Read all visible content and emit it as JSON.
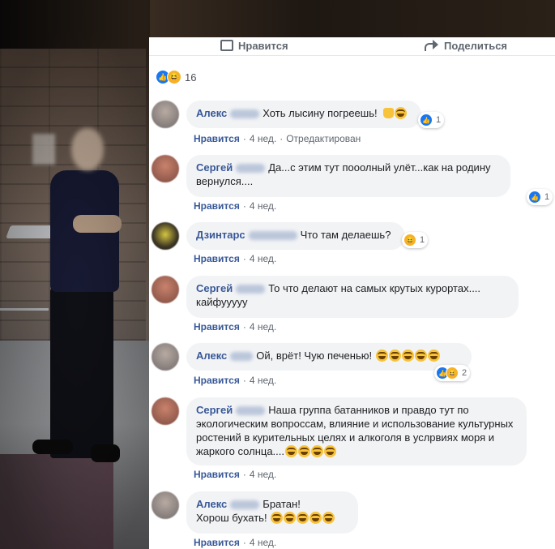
{
  "post": {
    "actions": {
      "like": "Нравится",
      "share": "Поделиться"
    },
    "reactions": {
      "count": "16"
    }
  },
  "comments": [
    {
      "author": "Алекс",
      "text": "Хоть лысину погреешь!",
      "emojis": [
        "thumbs-up",
        "laughing"
      ],
      "like": "Нравится",
      "time": "4 нед.",
      "edited": "Отредактирован",
      "reactions": {
        "types": [
          "like"
        ],
        "count": "1"
      }
    },
    {
      "author": "Сергей",
      "text": "Да...с этим тут пооолный улёт...как на родину вернулся....",
      "emojis": [],
      "like": "Нравится",
      "time": "4 нед.",
      "reactions": {
        "types": [
          "like"
        ],
        "count": "1"
      }
    },
    {
      "author": "Дзинтарс",
      "text": "Что там делаешь?",
      "emojis": [],
      "like": "Нравится",
      "time": "4 нед.",
      "reactions": {
        "types": [
          "haha"
        ],
        "count": "1"
      }
    },
    {
      "author": "Сергей",
      "text": "То что делают на самых крутых курортах.... кайфууууу",
      "emojis": [],
      "like": "Нравится",
      "time": "4 нед."
    },
    {
      "author": "Алекс",
      "text": "Ой, врёт! Чую печенью!",
      "emojis": [
        "laughing",
        "laughing",
        "laughing",
        "laughing",
        "laughing"
      ],
      "like": "Нравится",
      "time": "4 нед.",
      "reactions": {
        "types": [
          "like",
          "haha"
        ],
        "count": "2"
      }
    },
    {
      "author": "Сергей",
      "text": "Наша группа батанников и правдо тут по экологическим вопроссам, влияние и использование культурных ростений в курительных целях и алкоголя в услрвиях моря и жаркого солнца....",
      "emojis": [
        "laughing",
        "laughing",
        "laughing",
        "laughing"
      ],
      "like": "Нравится",
      "time": "4 нед."
    },
    {
      "author": "Алекс",
      "text_line1": "Братан!",
      "text_line2": "Хорош бухать!",
      "emojis": [
        "laughing",
        "laughing",
        "laughing",
        "laughing",
        "laughing"
      ],
      "like": "Нравится",
      "time": "4 нед."
    }
  ],
  "colors": {
    "link": "#385898",
    "bubble": "#f2f3f5",
    "meta": "#606770",
    "like": "#1877f2",
    "haha": "#f7b125"
  }
}
